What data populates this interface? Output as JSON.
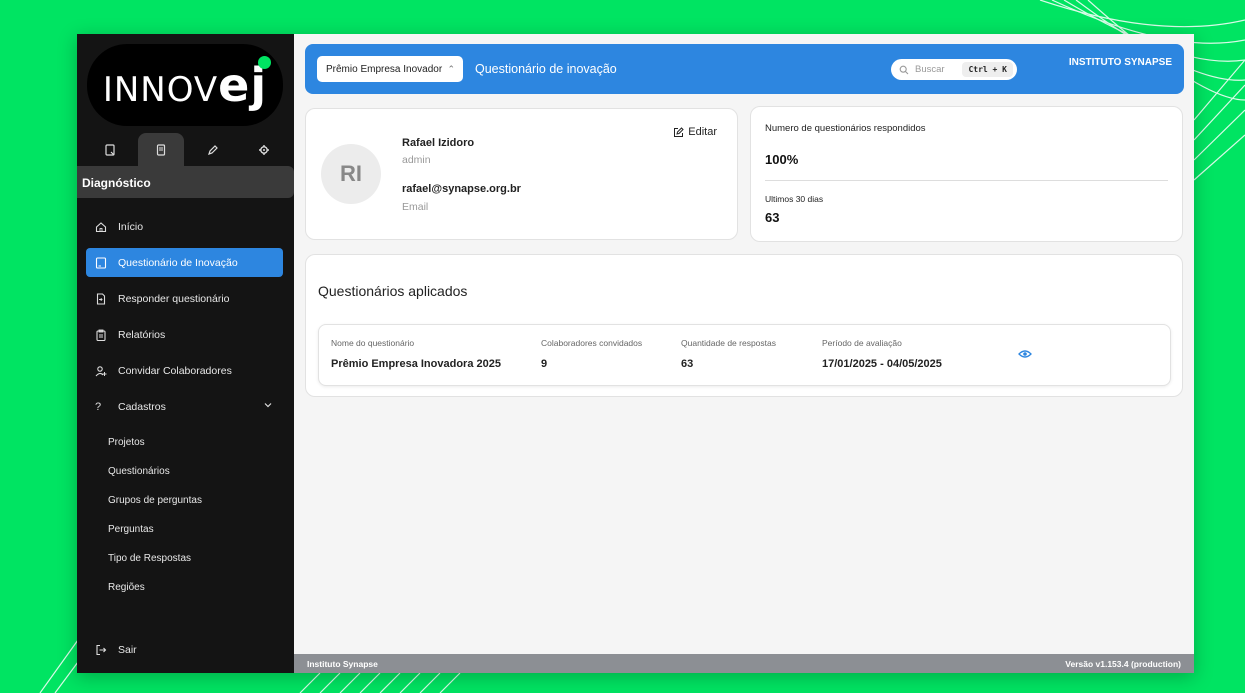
{
  "brand": {
    "logo_text": "INNOV",
    "logo_suffix": "ej"
  },
  "sidebar": {
    "icon_tabs": [
      "tablet-icon",
      "document-icon",
      "pen-icon",
      "gear-icon"
    ],
    "section": "Diagnóstico",
    "items": [
      {
        "label": "Início",
        "icon": "home-icon"
      },
      {
        "label": "Questionário de Inovação",
        "icon": "tablet-icon",
        "active": true
      },
      {
        "label": "Responder questionário",
        "icon": "file-arrow-icon"
      },
      {
        "label": "Relatórios",
        "icon": "clipboard-icon"
      },
      {
        "label": "Convidar Colaboradores",
        "icon": "user-add-icon"
      },
      {
        "label": "Cadastros",
        "icon": "question-icon",
        "expanded": true
      }
    ],
    "subitems": [
      "Projetos",
      "Questionários",
      "Grupos de perguntas",
      "Perguntas",
      "Tipo de Respostas",
      "Regiões"
    ],
    "logout": "Sair"
  },
  "topbar": {
    "project_select": "Prêmio Empresa Inovador",
    "title": "Questionário de inovação",
    "search_placeholder": "Buscar",
    "shortcut": "Ctrl + K",
    "org": "INSTITUTO SYNAPSE"
  },
  "profile": {
    "initials": "RI",
    "name": "Rafael Izidoro",
    "role": "admin",
    "email": "rafael@synapse.org.br",
    "email_label": "Email",
    "edit_label": "Editar"
  },
  "stats": {
    "answered_label": "Numero de questionários respondidos",
    "answered_value": "100%",
    "last30_label": "Ultimos 30 dias",
    "last30_value": "63"
  },
  "surveys": {
    "title": "Questionários aplicados",
    "columns": [
      "Nome do questionário",
      "Colaboradores convidados",
      "Quantidade de respostas",
      "Período de avaliação"
    ],
    "rows": [
      {
        "name": "Prêmio Empresa Inovadora 2025",
        "invited": "9",
        "responses": "63",
        "period": "17/01/2025 - 04/05/2025"
      }
    ]
  },
  "footer": {
    "left": "Instituto Synapse",
    "right": "Versão v1.153.4 (production)"
  },
  "colors": {
    "background": "#00e462",
    "accent": "#2d86e0",
    "sidebar": "#141414"
  }
}
